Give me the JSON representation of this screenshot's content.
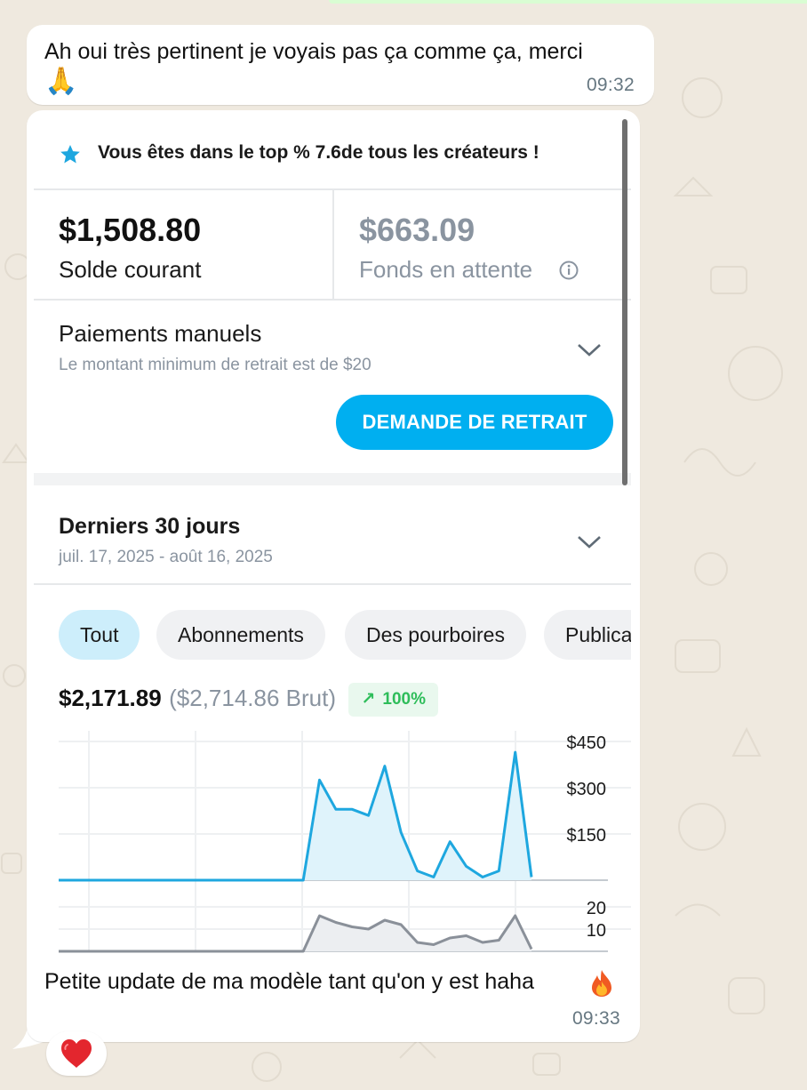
{
  "message_1": {
    "text": "Ah oui très pertinent je voyais pas ça comme ça, merci",
    "emoji": "🙏",
    "time": "09:32"
  },
  "screenshot": {
    "banner": "Vous êtes dans le top % 7.6de tous les créateurs !",
    "current_balance": {
      "amount": "$1,508.80",
      "label": "Solde courant"
    },
    "pending_balance": {
      "amount": "$663.09",
      "label": "Fonds en attente"
    },
    "manual_payments": {
      "title": "Paiements manuels",
      "subtitle": "Le montant minimum de retrait est de $20",
      "button": "DEMANDE DE RETRAIT"
    },
    "period": {
      "title": "Derniers 30 jours",
      "range": "juil. 17, 2025 - août 16, 2025"
    },
    "chips": [
      {
        "label": "Tout",
        "active": true
      },
      {
        "label": "Abonnements",
        "active": false
      },
      {
        "label": "Des pourboires",
        "active": false
      },
      {
        "label": "Publica",
        "active": false
      }
    ],
    "totals": {
      "net": "$2,171.89",
      "gross": "($2,714.86 Brut)",
      "change": "100%"
    }
  },
  "chart_data": [
    {
      "type": "area",
      "x": [
        1,
        2,
        3,
        4,
        5,
        6,
        7,
        8,
        9,
        10,
        11,
        12,
        13,
        14,
        15,
        16,
        17,
        18,
        19,
        20,
        21,
        22,
        23,
        24,
        25,
        26,
        27,
        28,
        29,
        30
      ],
      "values": [
        0,
        0,
        0,
        0,
        0,
        0,
        0,
        0,
        0,
        0,
        0,
        0,
        0,
        0,
        0,
        0,
        0,
        0,
        0,
        0,
        0,
        0,
        0,
        0,
        0,
        0,
        0,
        0,
        0,
        0
      ],
      "series": [
        {
          "values": [
            0,
            0,
            0,
            0,
            0,
            0,
            0,
            0,
            0,
            0,
            0,
            0,
            0,
            0,
            0,
            0,
            325,
            230,
            230,
            210,
            370,
            155,
            30,
            10,
            125,
            45,
            10,
            30,
            415,
            10
          ]
        }
      ],
      "yticks": [
        "$450",
        "$300",
        "$150"
      ],
      "ytick_values": [
        450,
        300,
        150
      ],
      "ylim": [
        0,
        450
      ],
      "color": "#1ea7df",
      "fill": "#dff3fb"
    },
    {
      "type": "area",
      "x": [
        1,
        2,
        3,
        4,
        5,
        6,
        7,
        8,
        9,
        10,
        11,
        12,
        13,
        14,
        15,
        16,
        17,
        18,
        19,
        20,
        21,
        22,
        23,
        24,
        25,
        26,
        27,
        28,
        29,
        30
      ],
      "series": [
        {
          "values": [
            0,
            0,
            0,
            0,
            0,
            0,
            0,
            0,
            0,
            0,
            0,
            0,
            0,
            0,
            0,
            0,
            16,
            13,
            11,
            10,
            14,
            12,
            4,
            3,
            6,
            7,
            4,
            5,
            16,
            1
          ]
        }
      ],
      "yticks": [
        "20",
        "10"
      ],
      "ytick_values": [
        20,
        10
      ],
      "ylim": [
        0,
        20
      ],
      "color": "#8a9099",
      "fill": "#eceef1"
    }
  ],
  "message_2": {
    "caption": "Petite update de ma modèle tant qu'on y est haha",
    "emoji": "🔥",
    "time": "09:33"
  },
  "reaction": {
    "emoji": "❤️"
  },
  "colors": {
    "accent": "#00aff0",
    "chat_background": "#efe9df",
    "positive": "#2ebd5a"
  }
}
